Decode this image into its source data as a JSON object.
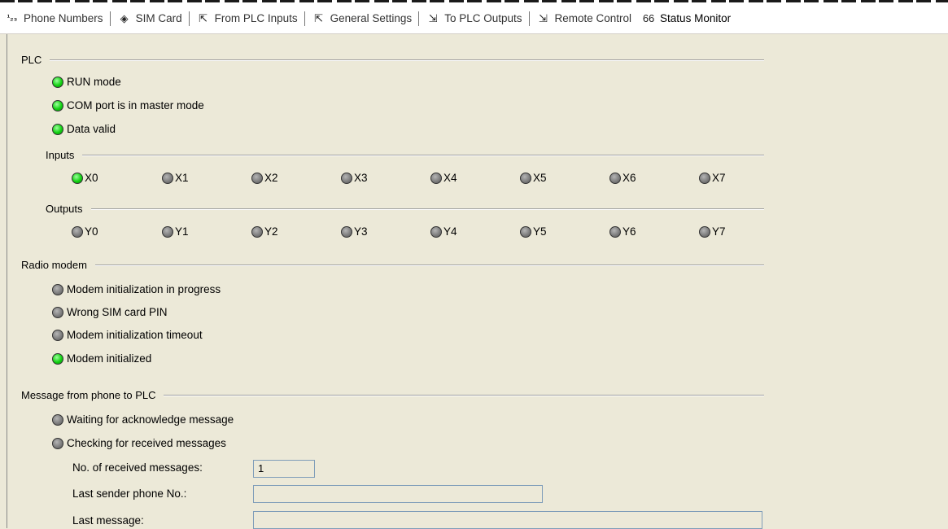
{
  "tabs": [
    {
      "label": "Phone Numbers",
      "icon": "phone-numbers-icon",
      "glyph": "¹₂₃",
      "active": false
    },
    {
      "label": "SIM Card",
      "icon": "sim-card-icon",
      "glyph": "◈",
      "active": false
    },
    {
      "label": "From PLC Inputs",
      "icon": "from-plc-inputs-icon",
      "glyph": "⇱",
      "active": false
    },
    {
      "label": "General Settings",
      "icon": "general-settings-icon",
      "glyph": "⇱",
      "active": false
    },
    {
      "label": "To PLC Outputs",
      "icon": "to-plc-outputs-icon",
      "glyph": "⇲",
      "active": false
    },
    {
      "label": "Remote Control",
      "icon": "remote-control-icon",
      "glyph": "⇲",
      "active": false
    },
    {
      "label": "Status Monitor",
      "icon": "glasses-icon",
      "glyph": "66",
      "active": true
    }
  ],
  "plc": {
    "title": "PLC",
    "run_mode": {
      "label": "RUN mode",
      "on": true
    },
    "com_master": {
      "label": "COM port is in master mode",
      "on": true
    },
    "data_valid": {
      "label": "Data valid",
      "on": true
    },
    "inputs_title": "Inputs",
    "inputs": [
      {
        "label": "X0",
        "on": true
      },
      {
        "label": "X1",
        "on": false
      },
      {
        "label": "X2",
        "on": false
      },
      {
        "label": "X3",
        "on": false
      },
      {
        "label": "X4",
        "on": false
      },
      {
        "label": "X5",
        "on": false
      },
      {
        "label": "X6",
        "on": false
      },
      {
        "label": "X7",
        "on": false
      }
    ],
    "outputs_title": "Outputs",
    "outputs": [
      {
        "label": "Y0",
        "on": false
      },
      {
        "label": "Y1",
        "on": false
      },
      {
        "label": "Y2",
        "on": false
      },
      {
        "label": "Y3",
        "on": false
      },
      {
        "label": "Y4",
        "on": false
      },
      {
        "label": "Y5",
        "on": false
      },
      {
        "label": "Y6",
        "on": false
      },
      {
        "label": "Y7",
        "on": false
      }
    ]
  },
  "radio": {
    "title": "Radio modem",
    "init_progress": {
      "label": "Modem initialization in progress",
      "on": false
    },
    "wrong_pin": {
      "label": "Wrong SIM card PIN",
      "on": false
    },
    "init_timeout": {
      "label": "Modem initialization timeout",
      "on": false
    },
    "initialized": {
      "label": "Modem initialized",
      "on": true
    }
  },
  "message": {
    "title": "Message from phone to PLC",
    "waiting_ack": {
      "label": "Waiting for acknowledge message",
      "on": false
    },
    "checking": {
      "label": "Checking for received messages",
      "on": false
    },
    "received_count_label": "No. of received messages:",
    "received_count_value": "1",
    "last_sender_label": "Last sender phone No.:",
    "last_sender_value": "",
    "last_message_label": "Last message:",
    "last_message_value": ""
  }
}
